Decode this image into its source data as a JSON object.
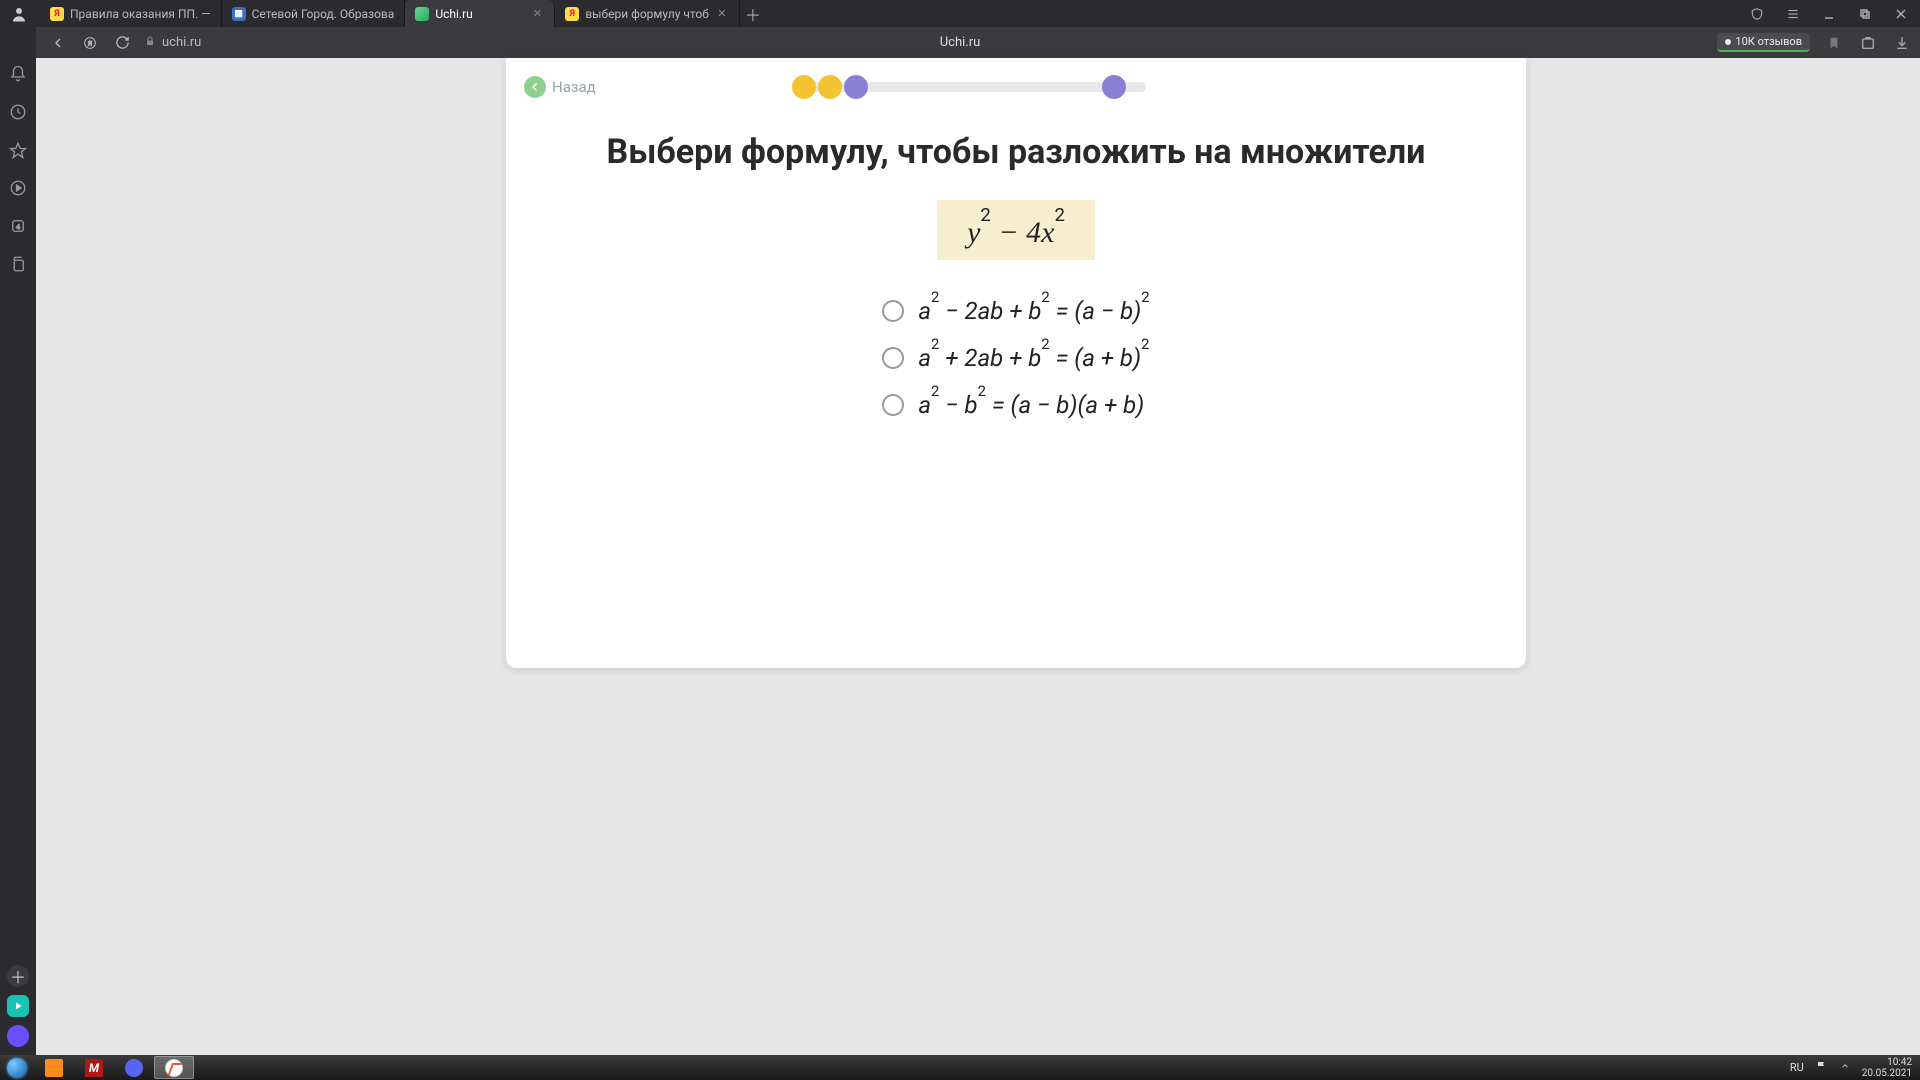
{
  "browser": {
    "tabs": [
      {
        "title": "Правила оказания ПП. —",
        "fav": "y"
      },
      {
        "title": "Сетевой Город. Образова",
        "fav": "b"
      },
      {
        "title": "Uchi.ru",
        "fav": "u",
        "active": true
      },
      {
        "title": "выбери формулу чтоб",
        "fav": "y"
      }
    ],
    "address_host": "uchi.ru",
    "page_title_center": "Uchi.ru",
    "reviews_label": "10К отзывов"
  },
  "lesson": {
    "back_label": "Назад",
    "question": "Выбери формулу, чтобы разложить на множители",
    "expression_html": "y<sup>2</sup> − 4x<sup>2</sup>",
    "options": [
      "a<sup>2</sup> − 2ab + b<sup>2</sup> = (a − b)<sup>2</sup>",
      "a<sup>2</sup> + 2ab + b<sup>2</sup> = (a + b)<sup>2</sup>",
      "a<sup>2</sup> − b<sup>2</sup> = (a − b)(a + b)"
    ]
  },
  "system": {
    "lang": "RU",
    "time": "10:42",
    "date": "20.05.2021"
  }
}
